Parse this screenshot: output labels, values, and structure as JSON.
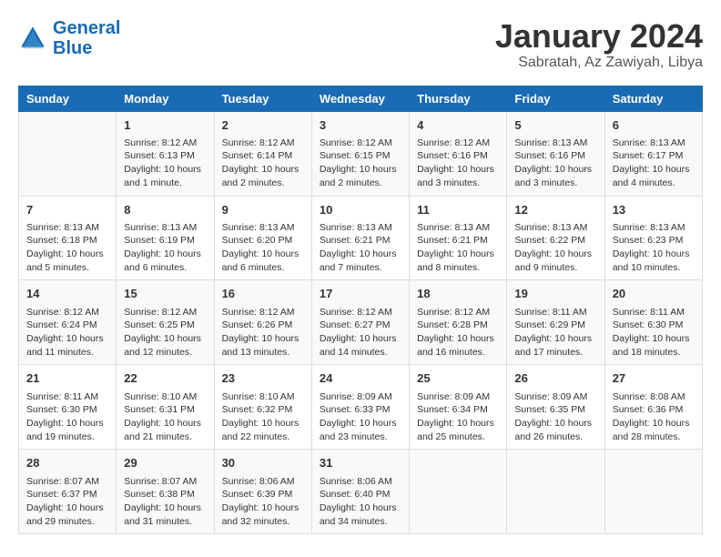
{
  "header": {
    "logo_line1": "General",
    "logo_line2": "Blue",
    "month": "January 2024",
    "location": "Sabratah, Az Zawiyah, Libya"
  },
  "weekdays": [
    "Sunday",
    "Monday",
    "Tuesday",
    "Wednesday",
    "Thursday",
    "Friday",
    "Saturday"
  ],
  "weeks": [
    [
      {
        "day": "",
        "info": ""
      },
      {
        "day": "1",
        "info": "Sunrise: 8:12 AM\nSunset: 6:13 PM\nDaylight: 10 hours and 1 minute."
      },
      {
        "day": "2",
        "info": "Sunrise: 8:12 AM\nSunset: 6:14 PM\nDaylight: 10 hours and 2 minutes."
      },
      {
        "day": "3",
        "info": "Sunrise: 8:12 AM\nSunset: 6:15 PM\nDaylight: 10 hours and 2 minutes."
      },
      {
        "day": "4",
        "info": "Sunrise: 8:12 AM\nSunset: 6:16 PM\nDaylight: 10 hours and 3 minutes."
      },
      {
        "day": "5",
        "info": "Sunrise: 8:13 AM\nSunset: 6:16 PM\nDaylight: 10 hours and 3 minutes."
      },
      {
        "day": "6",
        "info": "Sunrise: 8:13 AM\nSunset: 6:17 PM\nDaylight: 10 hours and 4 minutes."
      }
    ],
    [
      {
        "day": "7",
        "info": "Sunrise: 8:13 AM\nSunset: 6:18 PM\nDaylight: 10 hours and 5 minutes."
      },
      {
        "day": "8",
        "info": "Sunrise: 8:13 AM\nSunset: 6:19 PM\nDaylight: 10 hours and 6 minutes."
      },
      {
        "day": "9",
        "info": "Sunrise: 8:13 AM\nSunset: 6:20 PM\nDaylight: 10 hours and 6 minutes."
      },
      {
        "day": "10",
        "info": "Sunrise: 8:13 AM\nSunset: 6:21 PM\nDaylight: 10 hours and 7 minutes."
      },
      {
        "day": "11",
        "info": "Sunrise: 8:13 AM\nSunset: 6:21 PM\nDaylight: 10 hours and 8 minutes."
      },
      {
        "day": "12",
        "info": "Sunrise: 8:13 AM\nSunset: 6:22 PM\nDaylight: 10 hours and 9 minutes."
      },
      {
        "day": "13",
        "info": "Sunrise: 8:13 AM\nSunset: 6:23 PM\nDaylight: 10 hours and 10 minutes."
      }
    ],
    [
      {
        "day": "14",
        "info": "Sunrise: 8:12 AM\nSunset: 6:24 PM\nDaylight: 10 hours and 11 minutes."
      },
      {
        "day": "15",
        "info": "Sunrise: 8:12 AM\nSunset: 6:25 PM\nDaylight: 10 hours and 12 minutes."
      },
      {
        "day": "16",
        "info": "Sunrise: 8:12 AM\nSunset: 6:26 PM\nDaylight: 10 hours and 13 minutes."
      },
      {
        "day": "17",
        "info": "Sunrise: 8:12 AM\nSunset: 6:27 PM\nDaylight: 10 hours and 14 minutes."
      },
      {
        "day": "18",
        "info": "Sunrise: 8:12 AM\nSunset: 6:28 PM\nDaylight: 10 hours and 16 minutes."
      },
      {
        "day": "19",
        "info": "Sunrise: 8:11 AM\nSunset: 6:29 PM\nDaylight: 10 hours and 17 minutes."
      },
      {
        "day": "20",
        "info": "Sunrise: 8:11 AM\nSunset: 6:30 PM\nDaylight: 10 hours and 18 minutes."
      }
    ],
    [
      {
        "day": "21",
        "info": "Sunrise: 8:11 AM\nSunset: 6:30 PM\nDaylight: 10 hours and 19 minutes."
      },
      {
        "day": "22",
        "info": "Sunrise: 8:10 AM\nSunset: 6:31 PM\nDaylight: 10 hours and 21 minutes."
      },
      {
        "day": "23",
        "info": "Sunrise: 8:10 AM\nSunset: 6:32 PM\nDaylight: 10 hours and 22 minutes."
      },
      {
        "day": "24",
        "info": "Sunrise: 8:09 AM\nSunset: 6:33 PM\nDaylight: 10 hours and 23 minutes."
      },
      {
        "day": "25",
        "info": "Sunrise: 8:09 AM\nSunset: 6:34 PM\nDaylight: 10 hours and 25 minutes."
      },
      {
        "day": "26",
        "info": "Sunrise: 8:09 AM\nSunset: 6:35 PM\nDaylight: 10 hours and 26 minutes."
      },
      {
        "day": "27",
        "info": "Sunrise: 8:08 AM\nSunset: 6:36 PM\nDaylight: 10 hours and 28 minutes."
      }
    ],
    [
      {
        "day": "28",
        "info": "Sunrise: 8:07 AM\nSunset: 6:37 PM\nDaylight: 10 hours and 29 minutes."
      },
      {
        "day": "29",
        "info": "Sunrise: 8:07 AM\nSunset: 6:38 PM\nDaylight: 10 hours and 31 minutes."
      },
      {
        "day": "30",
        "info": "Sunrise: 8:06 AM\nSunset: 6:39 PM\nDaylight: 10 hours and 32 minutes."
      },
      {
        "day": "31",
        "info": "Sunrise: 8:06 AM\nSunset: 6:40 PM\nDaylight: 10 hours and 34 minutes."
      },
      {
        "day": "",
        "info": ""
      },
      {
        "day": "",
        "info": ""
      },
      {
        "day": "",
        "info": ""
      }
    ]
  ]
}
